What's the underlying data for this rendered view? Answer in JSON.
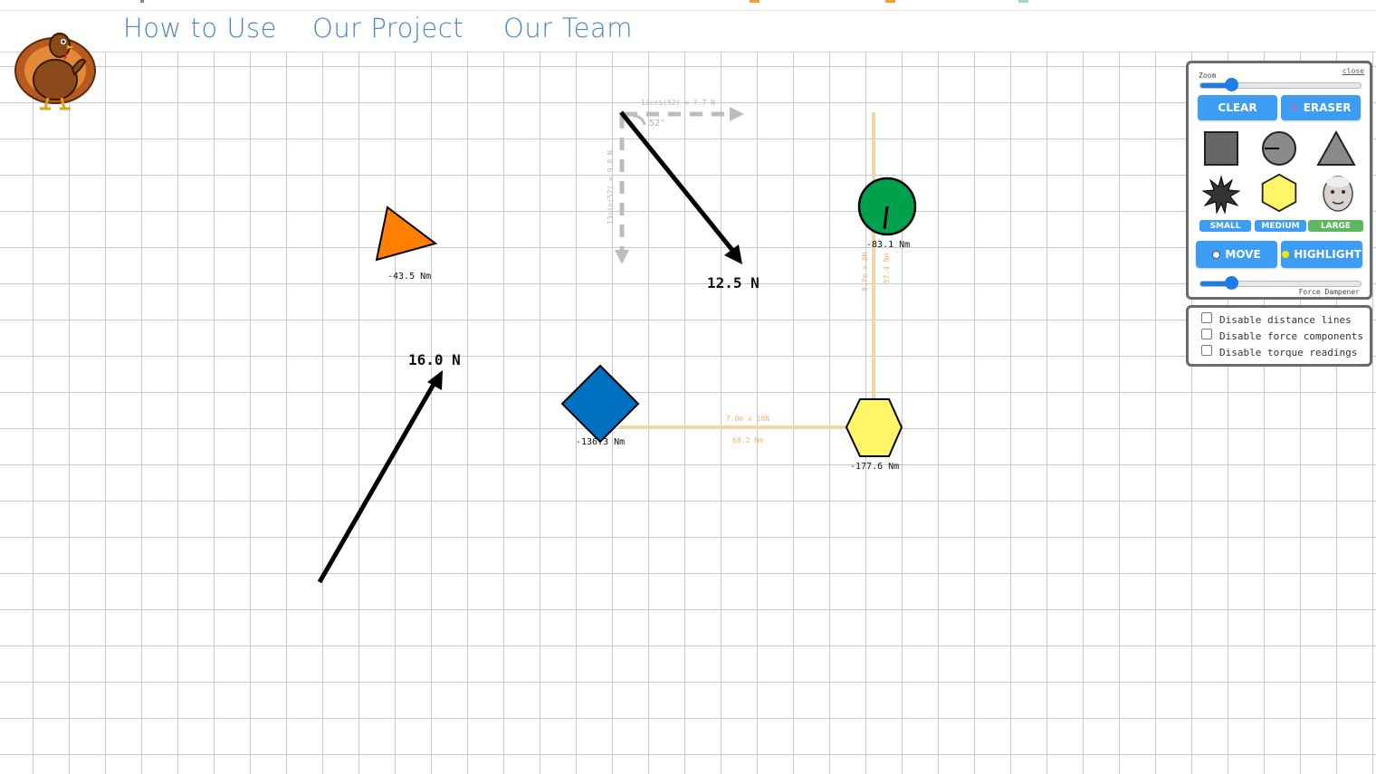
{
  "nav": {
    "links": [
      "How to Use",
      "Our Project",
      "Our Team"
    ]
  },
  "canvas": {
    "torque_readings": {
      "triangle": "-43.5 Nm",
      "circle": "-83.1 Nm",
      "diamond": "-136.3 Nm",
      "hexagon": "-177.6 Nm"
    },
    "forces": {
      "force_a": "12.5 N",
      "force_b": "16.0 N"
    },
    "components": {
      "horizontal": "13cos(52) = 7.7 N",
      "vertical": "13sin(52) = 9.8 N",
      "angle": "52°"
    },
    "distances": {
      "horizontal_top": "7.0m x 18N",
      "horizontal_bottom": "68.2 Nm",
      "vertical_left": "8.7m x 8N",
      "vertical_right": "-57.4 Nm"
    }
  },
  "panel": {
    "zoom_label": "Zoom",
    "close_label": "close",
    "zoom_level": 0.19,
    "clear_label": "CLEAR",
    "eraser_label": "ERASER",
    "shapes": [
      "square-shape",
      "circle-shape",
      "triangle-shape",
      "star-shape",
      "hexagon-shape",
      "face-shape"
    ],
    "sizes": [
      "SMALL",
      "MEDIUM",
      "LARGE"
    ],
    "active_size": "LARGE",
    "move_label": "MOVE",
    "highlight_label": "HIGHLIGHT",
    "damping_label": "Force Dampener",
    "damping_level": 0.19
  },
  "options": [
    "Disable distance lines",
    "Disable force components",
    "Disable torque readings"
  ],
  "colors": {
    "accent": "#3d9cf3",
    "active_size": "#5cb85c",
    "nav_link": "#4a86c5",
    "triangle": "#ff7f00",
    "circle": "#00a14b",
    "diamond": "#0070c0",
    "hexagon": "#fff566",
    "distance_line": "#f0d6a8"
  }
}
